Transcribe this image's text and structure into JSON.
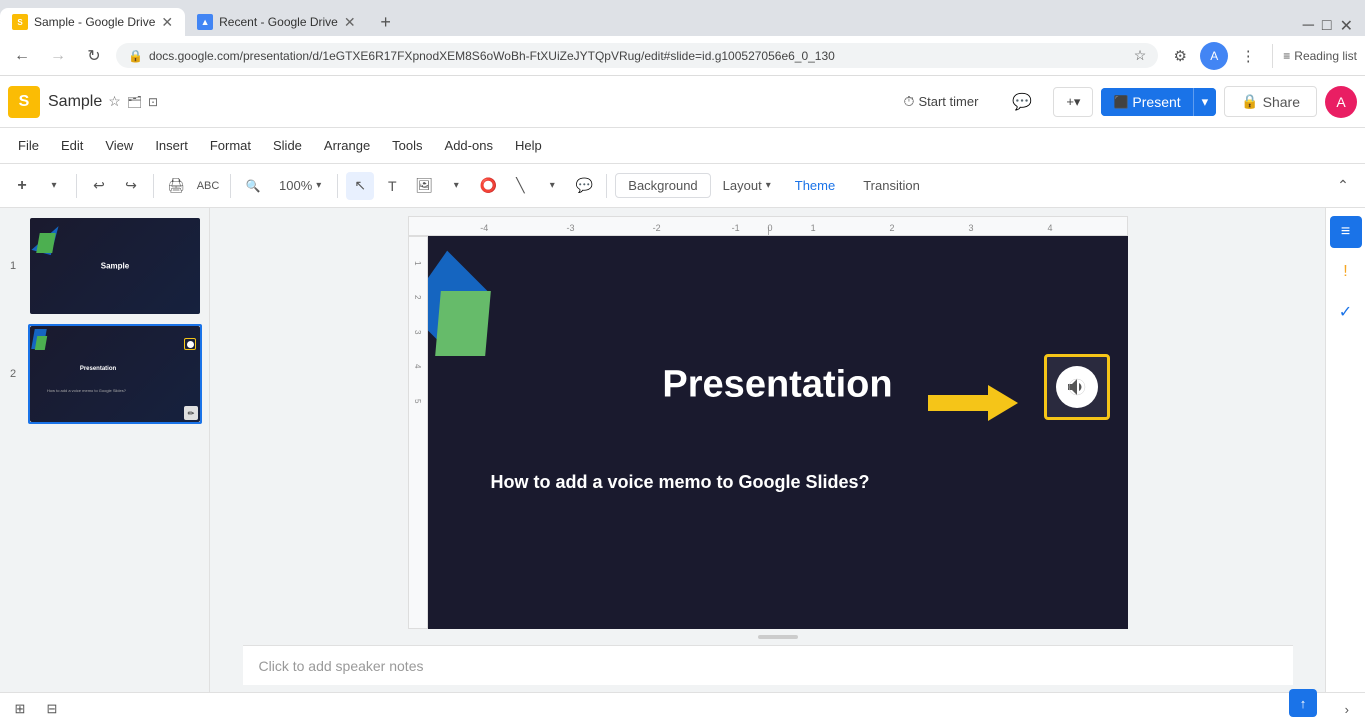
{
  "browser": {
    "tabs": [
      {
        "id": "tab1",
        "title": "Sample - Google Drive",
        "favicon_type": "gdoc",
        "favicon_label": "S",
        "active": true
      },
      {
        "id": "tab2",
        "title": "Recent - Google Drive",
        "favicon_type": "google-drive",
        "favicon_label": "G",
        "active": false
      }
    ],
    "new_tab_label": "+",
    "url": "docs.google.com/presentation/d/1eGTXE6R17FXpnodXEM8S6oWoBh-FtXUiZeJYTQpVRug/edit#slide=id.g100527056e6_0_130",
    "nav": {
      "back": "←",
      "forward": "→",
      "refresh": "↻"
    }
  },
  "app": {
    "logo_label": "S",
    "title": "Sample",
    "star_icon": "☆",
    "folder_icon": "🗂",
    "maximize_icon": "⊡",
    "start_timer_label": "Start timer",
    "comments_icon": "💬",
    "present_label": "Present",
    "present_dropdown": "▾",
    "share_label": "Share",
    "lock_icon": "🔒",
    "user_avatar": "A"
  },
  "menu": {
    "items": [
      "File",
      "Edit",
      "View",
      "Insert",
      "Format",
      "Slide",
      "Arrange",
      "Tools",
      "Add-ons",
      "Help"
    ]
  },
  "toolbar": {
    "zoom_level": "100%",
    "background_label": "Background",
    "layout_label": "Layout",
    "layout_arrow": "▾",
    "theme_label": "Theme",
    "transition_label": "Transition",
    "collapse_icon": "⌃"
  },
  "slides": [
    {
      "number": "1",
      "active": false
    },
    {
      "number": "2",
      "active": true
    }
  ],
  "slide_content": {
    "title": "Presentation",
    "subtitle": "How to add a voice memo to Google Slides?"
  },
  "notes": {
    "placeholder": "Click to add speaker notes"
  },
  "right_sidebar": {
    "icons": [
      "≡",
      "!",
      "✓"
    ]
  }
}
